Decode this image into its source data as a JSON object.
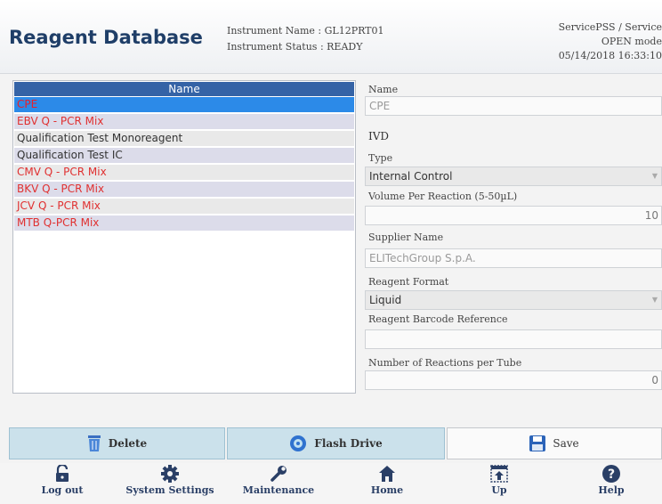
{
  "header": {
    "title": "Reagent Database",
    "instrument_name": "Instrument Name : GL12PRT01",
    "instrument_status": "Instrument Status : READY",
    "user": "ServicePSS / Service",
    "mode": "OPEN mode",
    "datetime": "05/14/2018 16:33:10"
  },
  "list": {
    "header": "Name",
    "items": [
      {
        "label": "CPE",
        "color": "#e8202a",
        "selected": true
      },
      {
        "label": "EBV Q - PCR Mix",
        "color": "#e03030"
      },
      {
        "label": "Qualification Test Monoreagent",
        "color": "#333333"
      },
      {
        "label": "Qualification Test IC",
        "color": "#333333"
      },
      {
        "label": "CMV Q - PCR Mix",
        "color": "#e03030"
      },
      {
        "label": "BKV Q - PCR Mix",
        "color": "#e03030"
      },
      {
        "label": "JCV Q - PCR Mix",
        "color": "#e03030"
      },
      {
        "label": "MTB Q-PCR Mix",
        "color": "#e03030"
      }
    ]
  },
  "details": {
    "name_label": "Name",
    "name_value": "CPE",
    "ivd_label": "IVD",
    "type_label": "Type",
    "type_value": "Internal Control",
    "volume_label": "Volume Per Reaction (5-50µL)",
    "volume_value": "10",
    "supplier_label": "Supplier Name",
    "supplier_value": "ELITechGroup S.p.A.",
    "format_label": "Reagent Format",
    "format_value": "Liquid",
    "barcode_label": "Reagent Barcode Reference",
    "barcode_value": "",
    "reactions_label": "Number of Reactions per Tube",
    "reactions_value": "0"
  },
  "actions": {
    "delete": "Delete",
    "flash_drive": "Flash Drive",
    "save": "Save"
  },
  "nav": {
    "logout": "Log out",
    "system_settings": "System Settings",
    "maintenance": "Maintenance",
    "home": "Home",
    "up": "Up",
    "help": "Help"
  },
  "icons": {
    "delete": "trash-icon",
    "flash_drive": "disc-icon",
    "save": "floppy-icon",
    "logout": "unlock-icon",
    "system_settings": "gear-icon",
    "maintenance": "wrench-icon",
    "home": "home-icon",
    "up": "up-icon",
    "help": "help-icon"
  },
  "colors": {
    "title": "#1f3e68",
    "list_header": "#3563a6",
    "selected_row": "#2c8ae8",
    "alert_text": "#e03030",
    "action_button": "#cbe1eb",
    "nav_icon": "#2a3f66"
  }
}
